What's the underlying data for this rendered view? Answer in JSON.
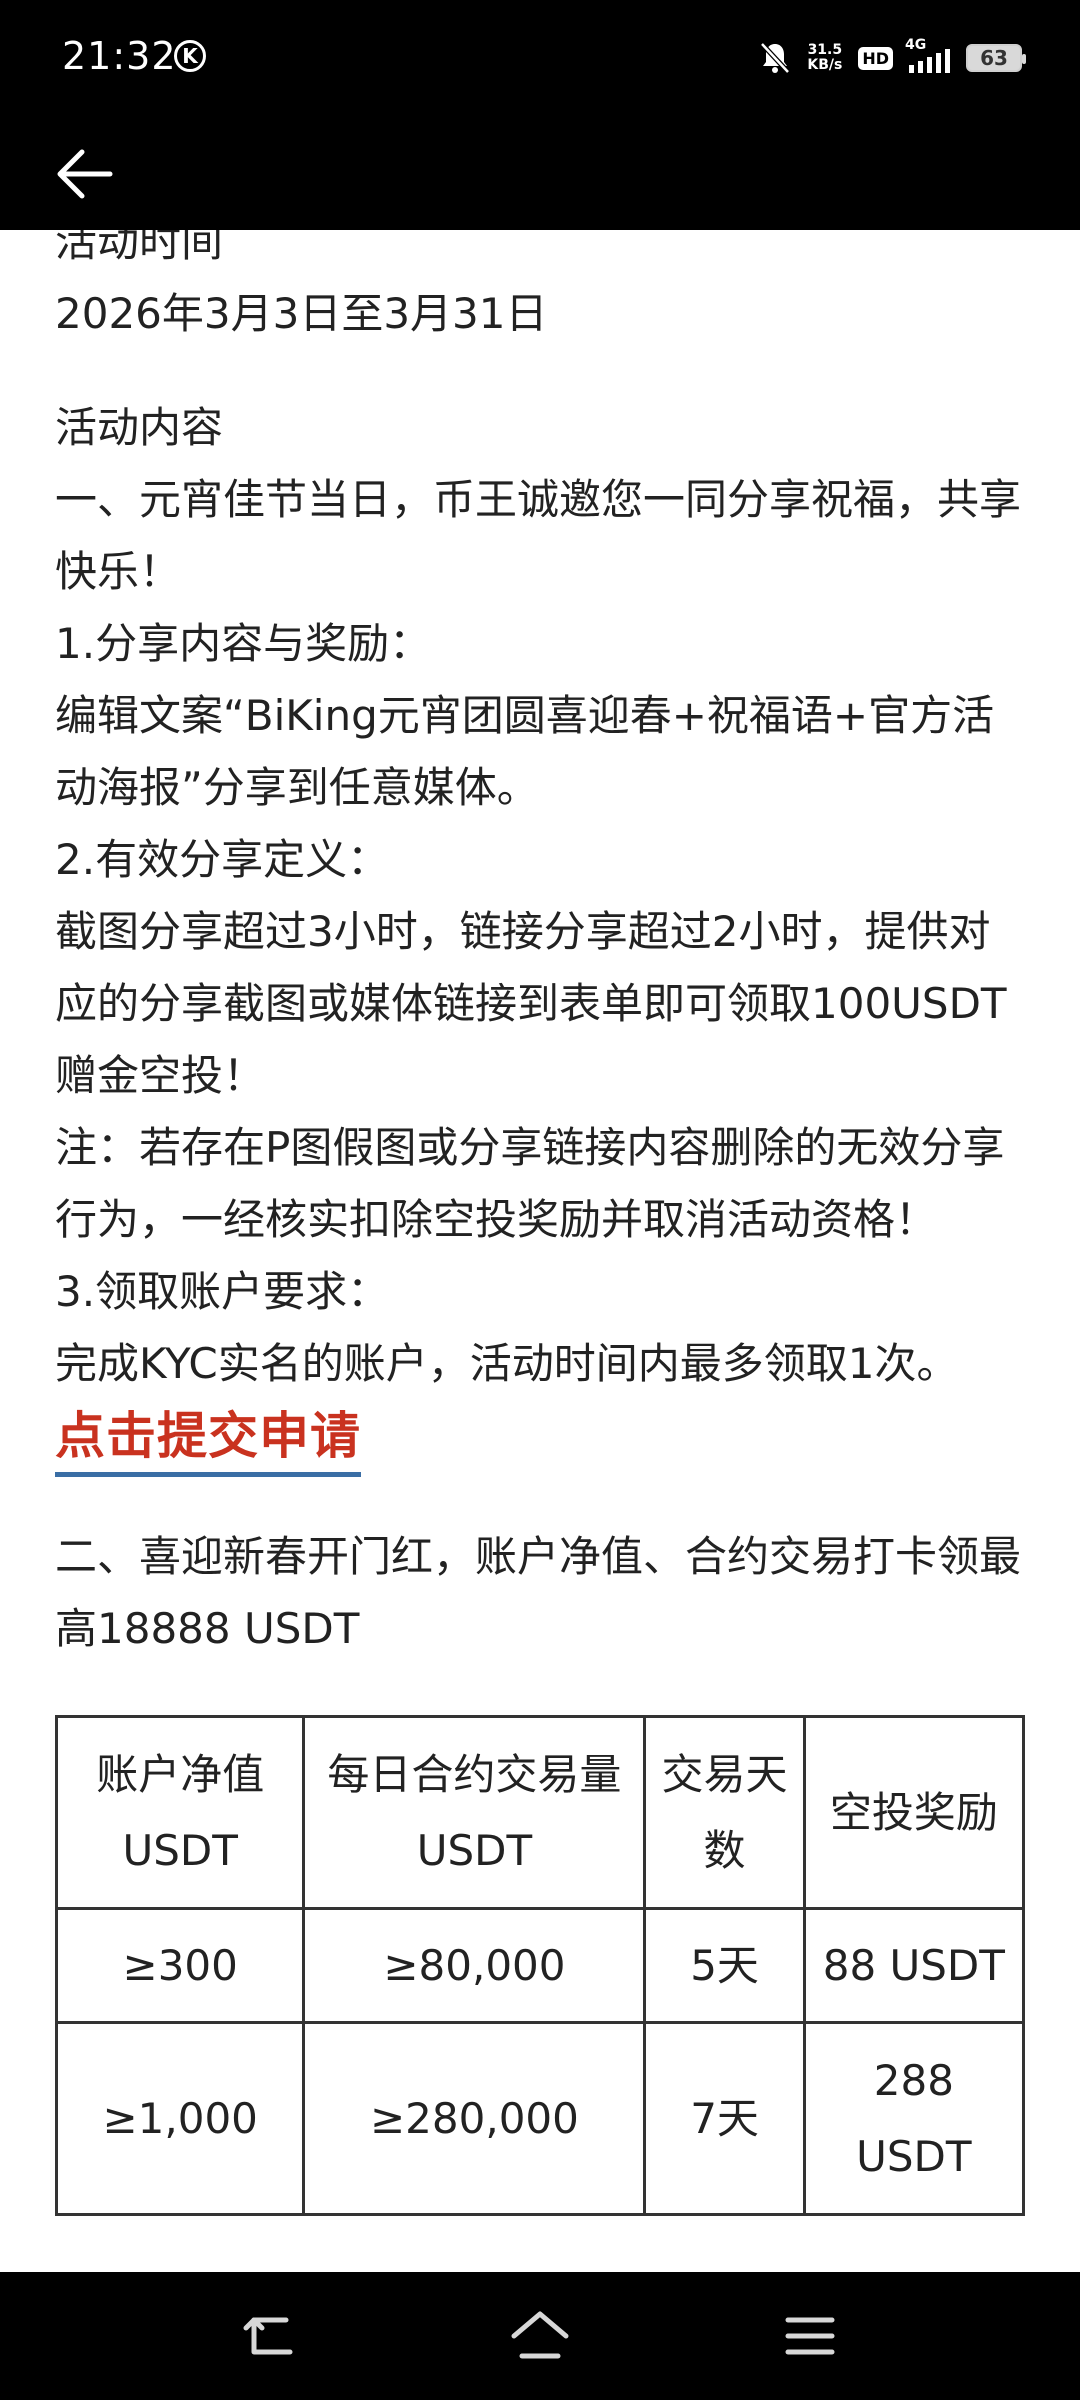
{
  "status_bar": {
    "time": "21:32",
    "carrier_badge": "K",
    "net_speed_value": "31.5",
    "net_speed_unit": "KB/s",
    "hd_label": "HD",
    "network_type": "4G",
    "battery_level": "63"
  },
  "content": {
    "event_time_heading": "活动时间",
    "event_time_value": "2026年3月3日至3月31日",
    "event_content_heading": "活动内容",
    "section1_title": "一、元宵佳节当日，币王诚邀您一同分享祝福，共享快乐！",
    "item1_heading": "1.分享内容与奖励：",
    "item1_body": "编辑文案“BiKing元宵团圆喜迎春+祝福语+官方活动海报”分享到任意媒体。",
    "item2_heading": "2.有效分享定义：",
    "item2_body": "截图分享超过3小时，链接分享超过2小时，提供对应的分享截图或媒体链接到表单即可领取100USDT赠金空投！",
    "item2_note": "注：若存在P图假图或分享链接内容删除的无效分享行为，一经核实扣除空投奖励并取消活动资格！",
    "item3_heading": "3.领取账户要求：",
    "item3_body": "完成KYC实名的账户，活动时间内最多领取1次。",
    "apply_link": "点击提交申请",
    "section2_title": "二、喜迎新春开门红，账户净值、合约交易打卡领最高18888 USDT"
  },
  "reward_table": {
    "headers": [
      "账户净值USDT",
      "每日合约交易量USDT",
      "交易天数",
      "空投奖励"
    ],
    "rows": [
      [
        "≥300",
        "≥80,000",
        "5天",
        "88 USDT"
      ],
      [
        "≥1,000",
        "≥280,000",
        "7天",
        "288 USDT"
      ]
    ]
  },
  "colors": {
    "link_red": "#c9321f",
    "link_underline": "#3a6ea5",
    "bar_background": "#000000"
  },
  "icons": {
    "back": "arrow-left-icon",
    "bell_muted": "bell-off-icon",
    "nav_back": "return-icon",
    "nav_home": "home-icon",
    "nav_menu": "menu-icon"
  }
}
